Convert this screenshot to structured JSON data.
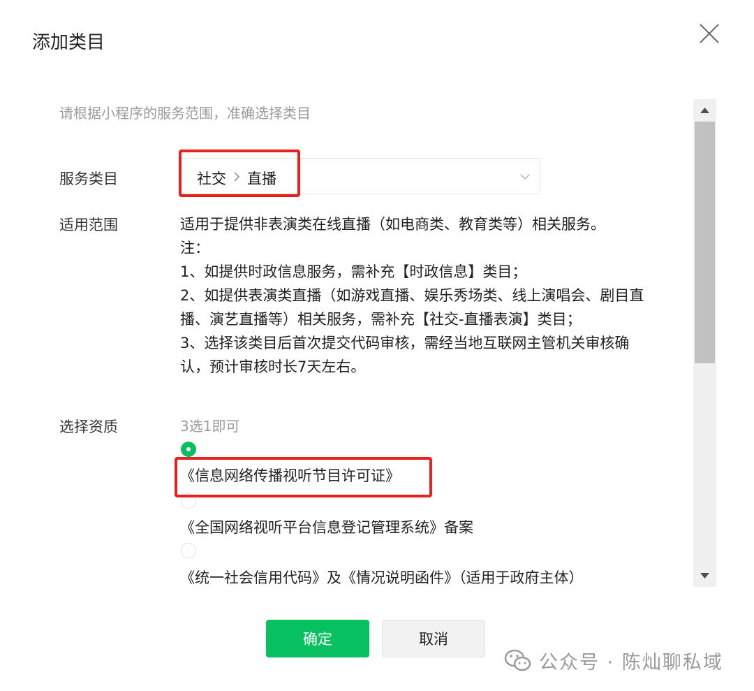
{
  "dialog": {
    "title": "添加类目"
  },
  "form": {
    "hint": "请根据小程序的服务范围，准确选择类目",
    "service_category": {
      "label": "服务类目",
      "value_level1": "社交",
      "separator": ">",
      "value_level2": "直播"
    },
    "scope": {
      "label": "适用范围",
      "lines": [
        "适用于提供非表演类在线直播（如电商类、教育类等）相关服务。",
        "注：",
        "1、如提供时政信息服务，需补充【时政信息】类目；",
        "2、如提供表演类直播（如游戏直播、娱乐秀场类、线上演唱会、剧目直",
        "播、演艺直播等）相关服务，需补充【社交-直播表演】类目；",
        "3、选择该类目后首次提交代码审核，需经当地互联网主管机关审核确",
        "认，预计审核时长7天左右。"
      ]
    },
    "qualification": {
      "label": "选择资质",
      "subtitle": "3选1即可",
      "options": [
        {
          "label": "《信息网络传播视听节目许可证》",
          "selected": true
        },
        {
          "label": "《全国网络视听平台信息登记管理系统》备案",
          "selected": false
        },
        {
          "label": "《统一社会信用代码》及《情况说明函件》（适用于政府主体）",
          "selected": false
        }
      ]
    }
  },
  "footer": {
    "confirm_label": "确定",
    "cancel_label": "取消"
  },
  "watermark": {
    "text": "公众号 · 陈灿聊私域"
  },
  "colors": {
    "accent": "#07c160",
    "highlight": "#e8201f",
    "muted_text": "#9b9b9b"
  }
}
